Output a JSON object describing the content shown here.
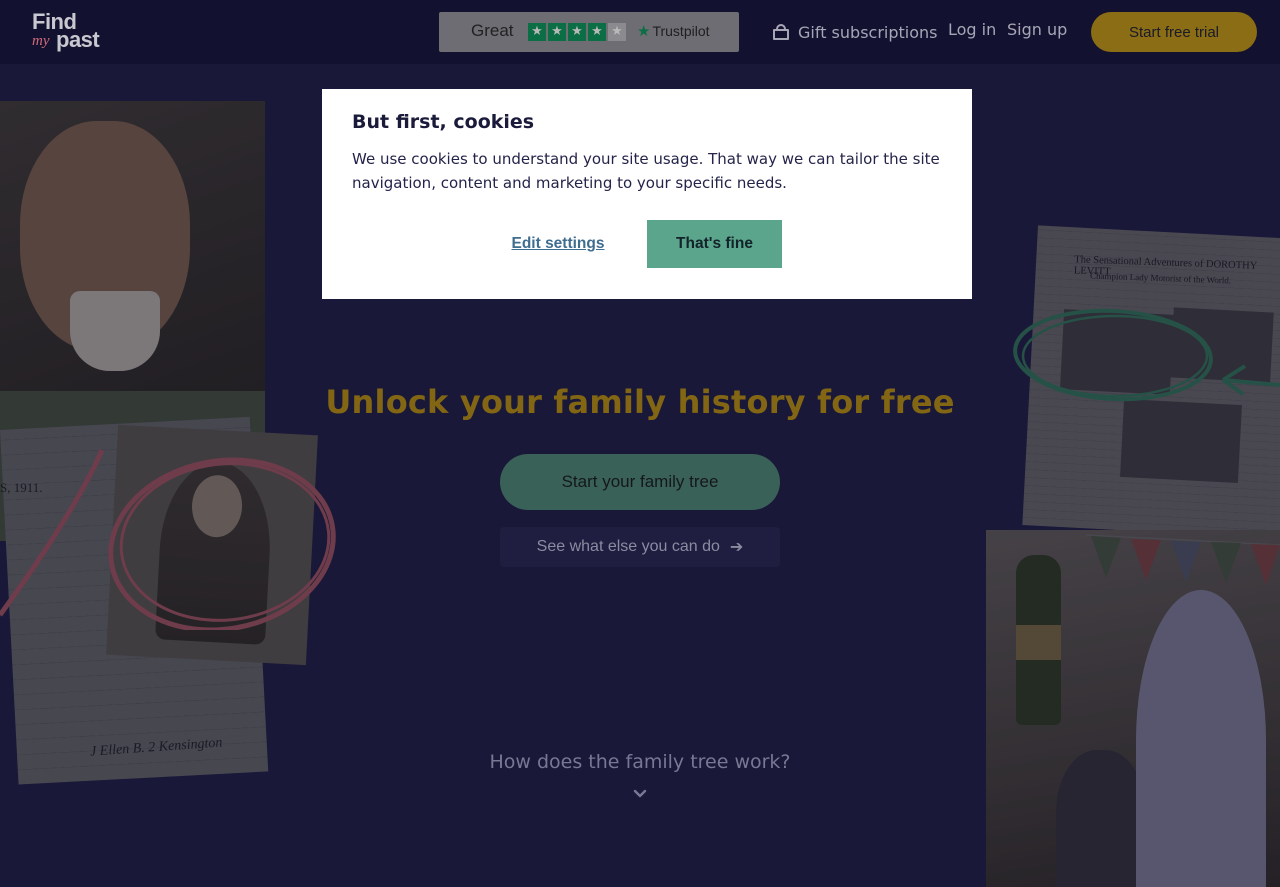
{
  "header": {
    "logo": {
      "find": "Find",
      "my": "my",
      "past": "past"
    },
    "trustpilot": {
      "rating": "Great",
      "stars": 4,
      "brand": "Trustpilot"
    },
    "nav": {
      "gift_label": "Gift subscriptions",
      "login_label": "Log in",
      "signup_label": "Sign up",
      "trial_label": "Start free trial"
    }
  },
  "hero": {
    "title": "Unlock your family history for free",
    "primary_cta": "Start your family tree",
    "secondary_cta": "See what else you can do",
    "how_link": "How does the family tree work?"
  },
  "background": {
    "census_year": "S, 1911.",
    "census_signature": "J Ellen B. 2 Kensington",
    "newspaper_headline": "The Sensational Adventures of DOROTHY LEVITT",
    "newspaper_subhead": "Champion Lady Motorist of the World."
  },
  "cookie_modal": {
    "title": "But first, cookies",
    "body": "We use cookies to understand your site usage. That way we can tailor the site navigation, content and marketing to your specific needs.",
    "edit_label": "Edit settings",
    "accept_label": "That's fine"
  },
  "colors": {
    "header_bg": "#121230",
    "page_bg": "#1b1a3d",
    "accent_gold": "#826614",
    "primary_green": "#3a6157",
    "modal_green": "#5aa58c",
    "link_blue": "#3f6d8f"
  }
}
